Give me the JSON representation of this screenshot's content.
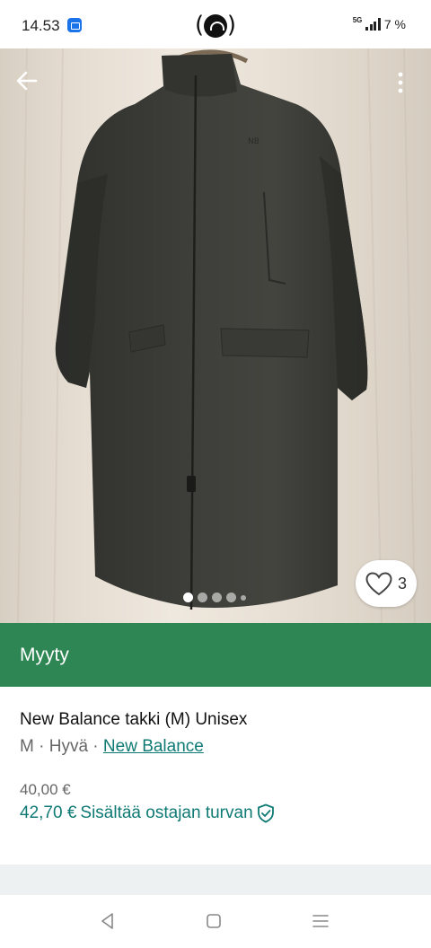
{
  "status_bar": {
    "time": "14.53",
    "network": "5G",
    "battery": "7 %"
  },
  "listing": {
    "like_count": "3",
    "image_count": 5,
    "active_image": 1,
    "sold_label": "Myyty",
    "title": "New Balance takki (M) Unisex",
    "size": "M",
    "separator": "·",
    "condition": "Hyvä",
    "brand": "New Balance",
    "price": "40,00 €",
    "buyer_price": "42,70 €",
    "buyer_protection": "Sisältää ostajan turvan"
  },
  "colors": {
    "accent": "#0f7a74",
    "sold_banner": "#2d8653",
    "coat": "#3a3a36"
  },
  "icons": {
    "back": "arrow-left-icon",
    "more": "more-vertical-icon",
    "like": "heart-icon",
    "protection": "shield-check-icon"
  }
}
